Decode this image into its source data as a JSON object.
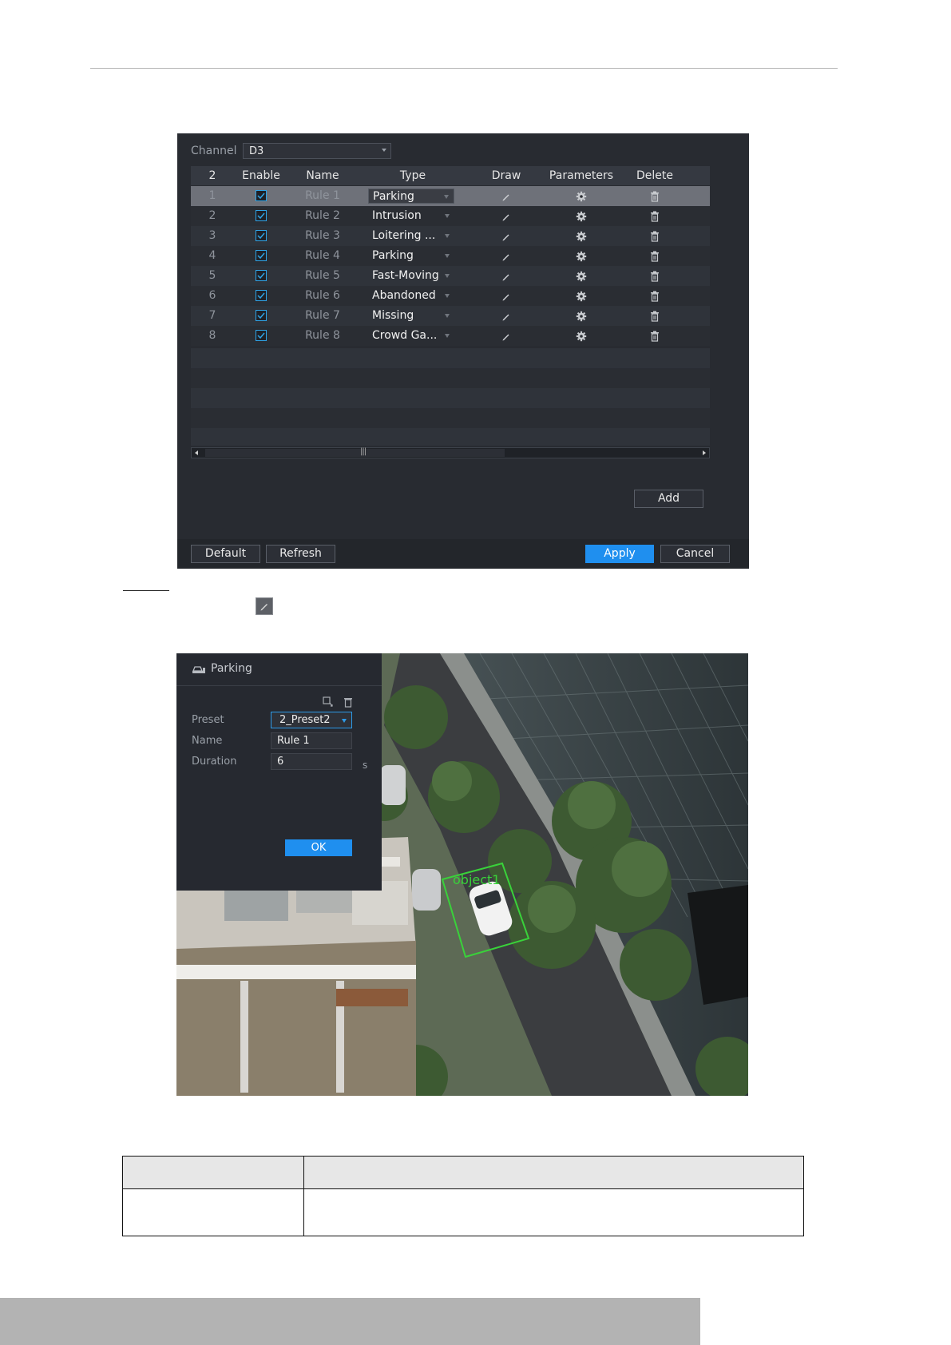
{
  "rule_panel": {
    "channel_label": "Channel",
    "channel_value": "D3",
    "headers": [
      "2",
      "Enable",
      "Name",
      "Type",
      "Draw",
      "Parameters",
      "Delete"
    ],
    "rows": [
      {
        "no": "1",
        "name": "Rule 1",
        "type": "Parking",
        "enabled": true,
        "selected": true
      },
      {
        "no": "2",
        "name": "Rule 2",
        "type": "Intrusion",
        "enabled": true,
        "selected": false
      },
      {
        "no": "3",
        "name": "Rule 3",
        "type": "Loitering ...",
        "enabled": true,
        "selected": false
      },
      {
        "no": "4",
        "name": "Rule 4",
        "type": "Parking",
        "enabled": true,
        "selected": false
      },
      {
        "no": "5",
        "name": "Rule 5",
        "type": "Fast-Moving",
        "enabled": true,
        "selected": false
      },
      {
        "no": "6",
        "name": "Rule 6",
        "type": "Abandoned",
        "enabled": true,
        "selected": false
      },
      {
        "no": "7",
        "name": "Rule 7",
        "type": "Missing",
        "enabled": true,
        "selected": false
      },
      {
        "no": "8",
        "name": "Rule 8",
        "type": "Crowd Ga...",
        "enabled": true,
        "selected": false
      }
    ],
    "buttons": {
      "add": "Add",
      "default": "Default",
      "refresh": "Refresh",
      "apply": "Apply",
      "cancel": "Cancel"
    }
  },
  "parking_panel": {
    "title": "Parking",
    "preset_label": "Preset",
    "preset_value": "2_Preset2",
    "name_label": "Name",
    "name_value": "Rule 1",
    "duration_label": "Duration",
    "duration_value": "6",
    "duration_unit": "s",
    "ok_label": "OK",
    "object_label": "object1"
  },
  "colors": {
    "accent": "#1f8fef",
    "panel_bg": "#282b31",
    "detect_box": "#39d23a"
  }
}
